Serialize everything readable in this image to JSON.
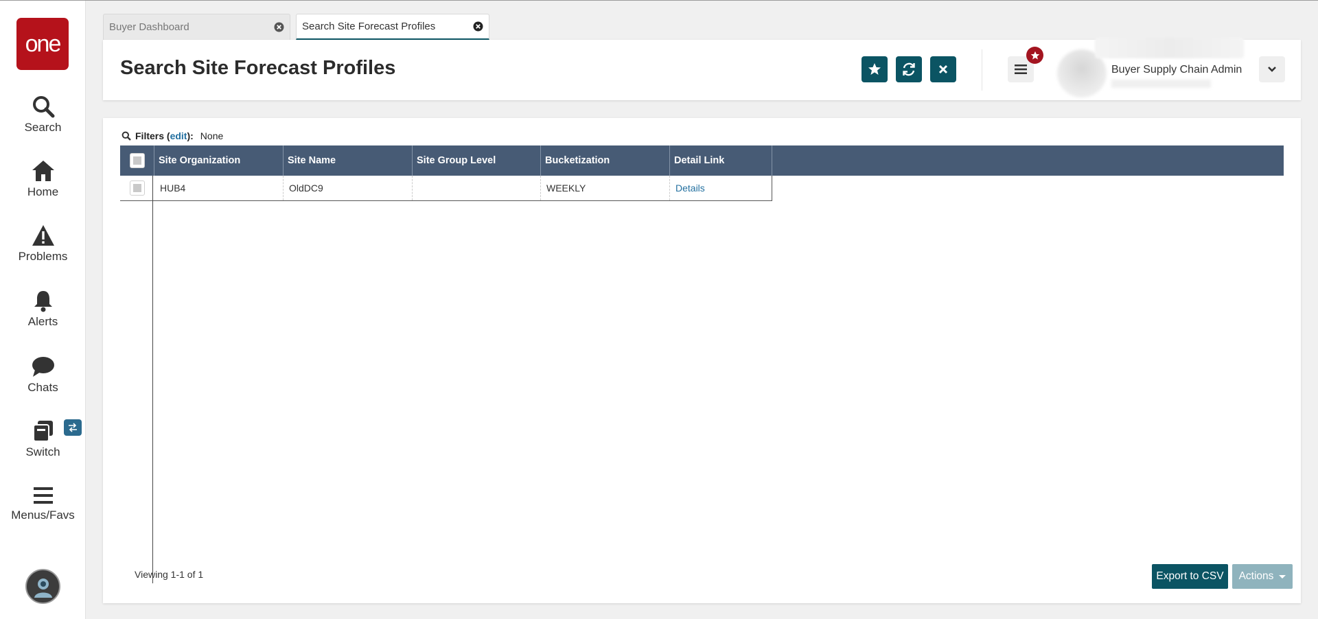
{
  "sidebar": {
    "logo_text": "one",
    "items": [
      {
        "label": "Search",
        "icon": "search-icon"
      },
      {
        "label": "Home",
        "icon": "home-icon"
      },
      {
        "label": "Problems",
        "icon": "warning-icon"
      },
      {
        "label": "Alerts",
        "icon": "bell-icon"
      },
      {
        "label": "Chats",
        "icon": "chat-bubble-icon"
      },
      {
        "label": "Switch",
        "icon": "switch-icon"
      },
      {
        "label": "Menus/Favs",
        "icon": "hamburger-icon"
      }
    ]
  },
  "tabs": [
    {
      "label": "Buyer Dashboard",
      "active": false
    },
    {
      "label": "Search Site Forecast Profiles",
      "active": true
    }
  ],
  "header": {
    "title": "Search Site Forecast Profiles",
    "user_role": "Buyer Supply Chain Admin",
    "icons": [
      "star-icon",
      "refresh-icon",
      "close-icon",
      "menu-icon",
      "chevron-down-icon"
    ]
  },
  "filters": {
    "label": "Filters",
    "edit_label": "edit",
    "value": "None"
  },
  "table": {
    "columns": [
      "Site Organization",
      "Site Name",
      "Site Group Level",
      "Bucketization",
      "Detail Link"
    ],
    "rows": [
      {
        "site_organization": "HUB4",
        "site_name": "OldDC9",
        "site_group_level": "",
        "bucketization": "WEEKLY",
        "detail_link": "Details"
      }
    ]
  },
  "footer": {
    "viewing": "Viewing 1-1 of 1",
    "export_label": "Export to CSV",
    "actions_label": "Actions"
  },
  "colors": {
    "brand": "#b5121b",
    "primary": "#0b5463",
    "grid_header": "#475b75",
    "link": "#2370a0"
  }
}
